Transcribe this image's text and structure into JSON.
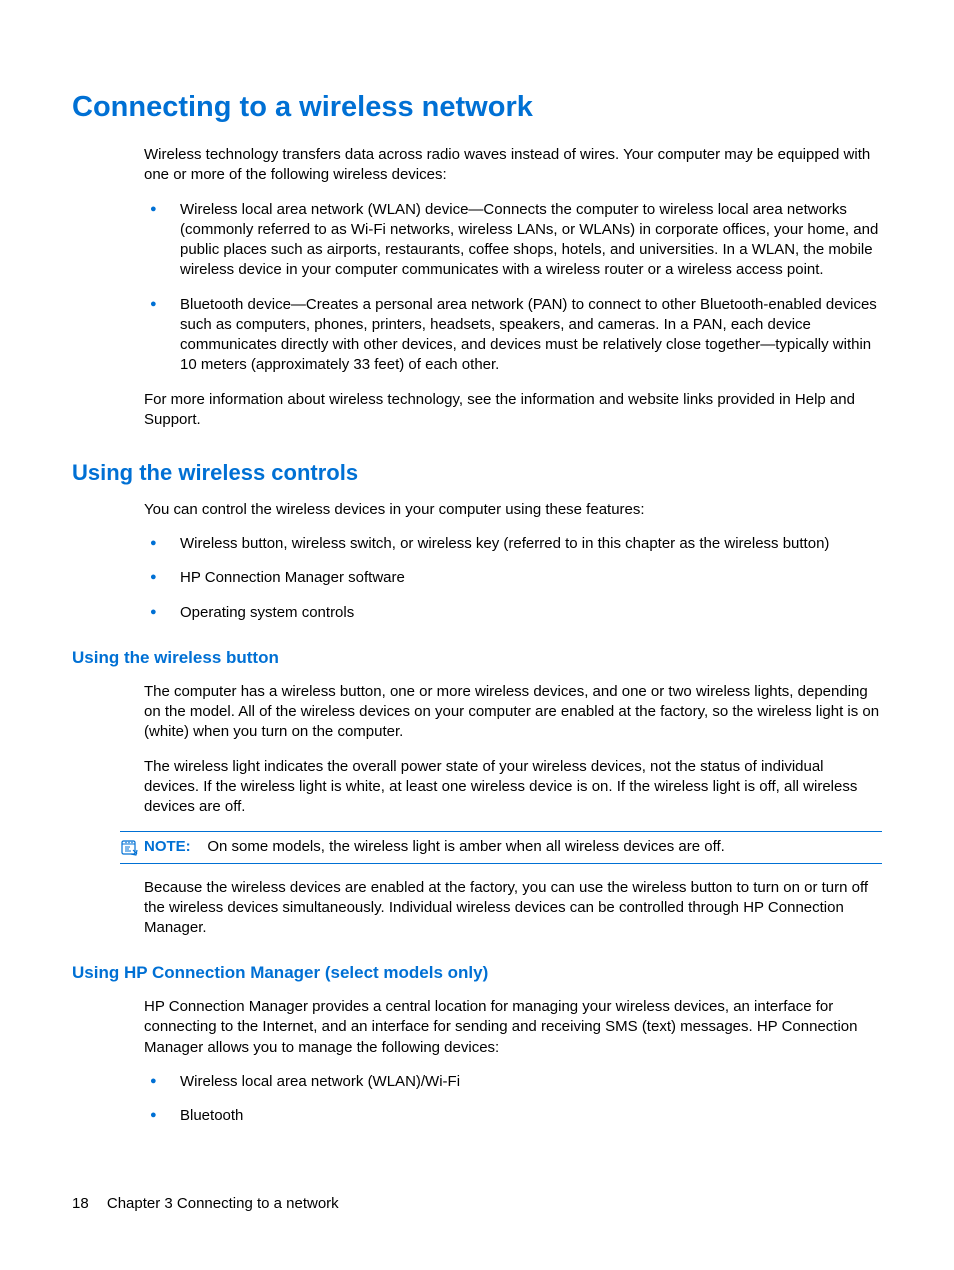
{
  "h1": "Connecting to a wireless network",
  "intro": "Wireless technology transfers data across radio waves instead of wires. Your computer may be equipped with one or more of the following wireless devices:",
  "wireless_devices": [
    "Wireless local area network (WLAN) device—Connects the computer to wireless local area networks (commonly referred to as Wi-Fi networks, wireless LANs, or WLANs) in corporate offices, your home, and public places such as airports, restaurants, coffee shops, hotels, and universities. In a WLAN, the mobile wireless device in your computer communicates with a wireless router or a wireless access point.",
    "Bluetooth device—Creates a personal area network (PAN) to connect to other Bluetooth-enabled devices such as computers, phones, printers, headsets, speakers, and cameras. In a PAN, each device communicates directly with other devices, and devices must be relatively close together—typically within 10 meters (approximately 33 feet) of each other."
  ],
  "more_info": "For more information about wireless technology, see the information and website links provided in Help and Support.",
  "h2_controls": "Using the wireless controls",
  "controls_intro": "You can control the wireless devices in your computer using these features:",
  "controls_list": [
    "Wireless button, wireless switch, or wireless key (referred to in this chapter as the wireless button)",
    "HP Connection Manager software",
    "Operating system controls"
  ],
  "h3_button": "Using the wireless button",
  "button_p1": "The computer has a wireless button, one or more wireless devices, and one or two wireless lights, depending on the model. All of the wireless devices on your computer are enabled at the factory, so the wireless light is on (white) when you turn on the computer.",
  "button_p2": "The wireless light indicates the overall power state of your wireless devices, not the status of individual devices. If the wireless light is white, at least one wireless device is on. If the wireless light is off, all wireless devices are off.",
  "note_label": "NOTE:",
  "note_text": "On some models, the wireless light is amber when all wireless devices are off.",
  "button_p3": "Because the wireless devices are enabled at the factory, you can use the wireless button to turn on or turn off the wireless devices simultaneously. Individual wireless devices can be controlled through HP Connection Manager.",
  "h3_hpcm": "Using HP Connection Manager (select models only)",
  "hpcm_p1": "HP Connection Manager provides a central location for managing your wireless devices, an interface for connecting to the Internet, and an interface for sending and receiving SMS (text) messages. HP Connection Manager allows you to manage the following devices:",
  "hpcm_list": [
    "Wireless local area network (WLAN)/Wi-Fi",
    "Bluetooth"
  ],
  "footer": {
    "page": "18",
    "chapter": "Chapter 3   Connecting to a network"
  }
}
